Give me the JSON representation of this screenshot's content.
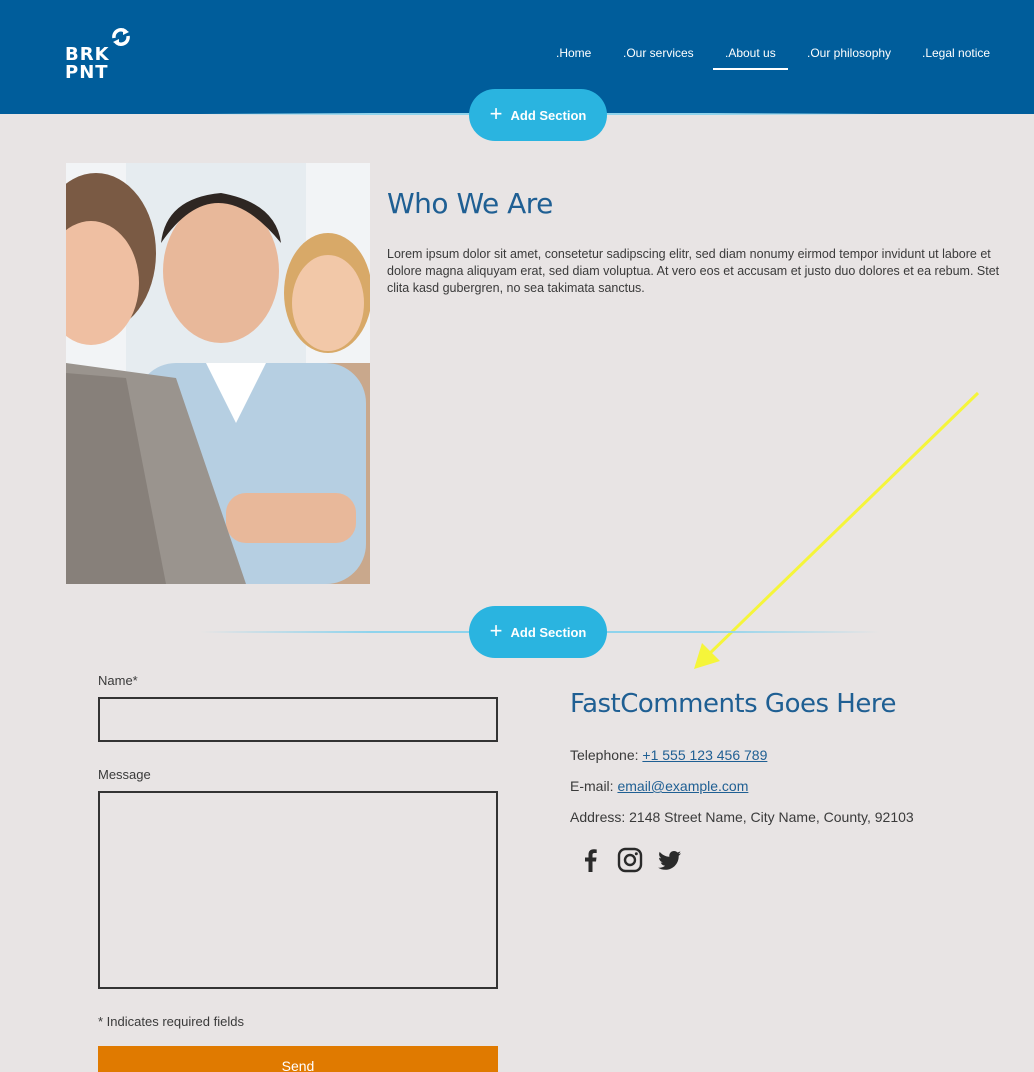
{
  "header": {
    "logo_line1": "BRK",
    "logo_line2": "PNT",
    "nav": [
      {
        "label": ".Home",
        "active": false
      },
      {
        "label": ".Our services",
        "active": false
      },
      {
        "label": ".About us",
        "active": true
      },
      {
        "label": ".Our philosophy",
        "active": false
      },
      {
        "label": ".Legal notice",
        "active": false
      }
    ]
  },
  "editor": {
    "add_section_label": "Add Section"
  },
  "about": {
    "title": "Who We Are",
    "body": "Lorem ipsum dolor sit amet, consetetur sadipscing elitr, sed diam nonumy eirmod tempor invidunt ut labore et dolore magna aliquyam erat, sed diam voluptua. At vero eos et accusam et justo duo dolores et ea rebum. Stet clita kasd gubergren, no sea takimata sanctus."
  },
  "form": {
    "name_label": "Name*",
    "name_value": "",
    "message_label": "Message",
    "message_value": "",
    "required_note": "* Indicates required fields",
    "send_label": "Send"
  },
  "contact": {
    "title": "FastComments Goes Here",
    "telephone_label": "Telephone:",
    "telephone_value": "+1 555 123 456 789",
    "email_label": "E-mail:",
    "email_value": "email@example.com",
    "address_label": "Address:",
    "address_value": "2148  Street Name, City Name, County, 92103",
    "social_icons": [
      "facebook-icon",
      "instagram-icon",
      "twitter-icon"
    ]
  },
  "colors": {
    "header_bg": "#005d9b",
    "page_bg": "#e8e4e4",
    "accent_button": "#2ab4e0",
    "heading_blue": "#1f5f93",
    "send_button": "#e07a00",
    "annotation_arrow": "#f5f53a"
  }
}
